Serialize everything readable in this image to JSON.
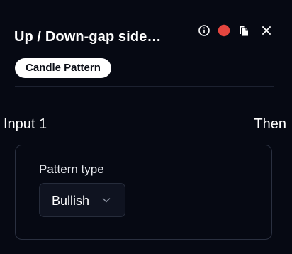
{
  "header": {
    "title": "Up / Down-gap side…",
    "tag": "Candle Pattern",
    "icons": [
      "info-icon",
      "status-dot-icon",
      "copy-icon",
      "close-icon"
    ],
    "status_dot_color": "#e5463f"
  },
  "flow": {
    "input_label": "Input 1",
    "then_label": "Then"
  },
  "card": {
    "field_label": "Pattern type",
    "select_value": "Bullish"
  }
}
